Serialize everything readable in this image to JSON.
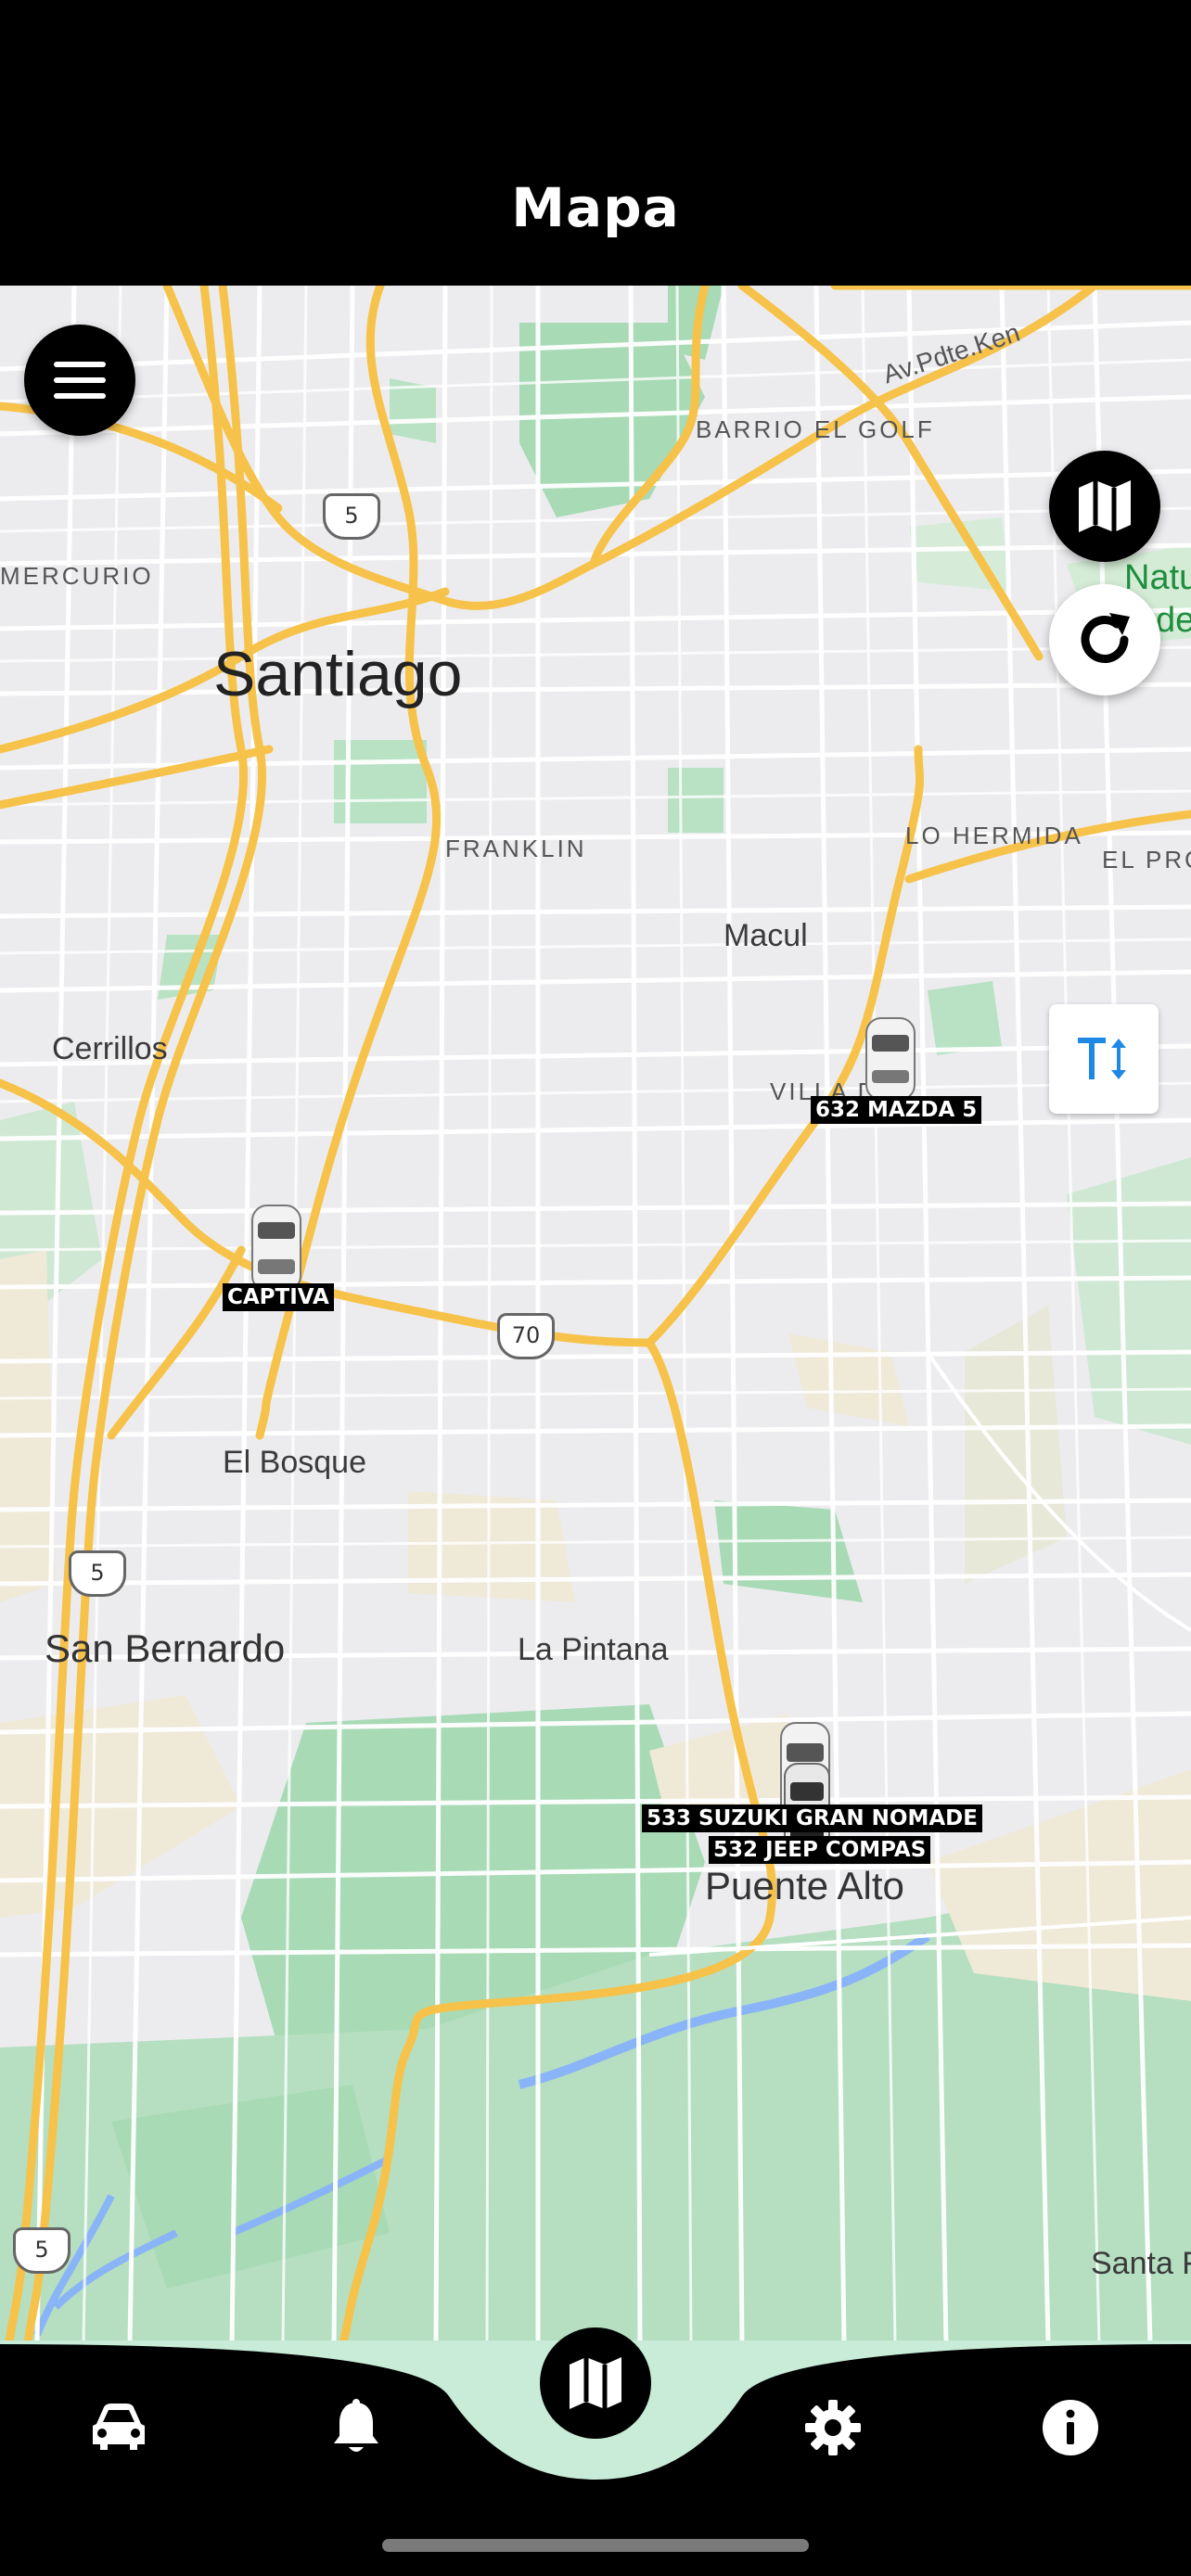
{
  "header": {
    "title": "Mapa"
  },
  "map": {
    "places": {
      "santiago": "Santiago",
      "barrio_el_golf": "BARRIO EL GOLF",
      "mercurio": "MERCURIO",
      "franklin": "FRANKLIN",
      "macul": "Macul",
      "cerrillos": "Cerrillos",
      "lo_hermida": "LO HERMIDA",
      "el_pro": "EL PRO",
      "villa": "VILLA D",
      "el_bosque": "El Bosque",
      "san_bernardo": "San Bernardo",
      "la_pintana": "La Pintana",
      "puente_alto": "Puente Alto",
      "santa": "Santa F",
      "park_1": "Natu",
      "park_2": "de",
      "road_pdte": "Av.Pdte.Ken"
    },
    "shields": {
      "route_5": "5",
      "route_70": "70"
    },
    "vehicles": [
      {
        "label": "632 MAZDA 5"
      },
      {
        "label": "CAPTIVA"
      },
      {
        "label": "533 SUZUKI GRAN NOMADE"
      },
      {
        "label": "532 JEEP COMPAS"
      }
    ],
    "colors": {
      "road_major": "#f6c24a",
      "water": "#8ab4f8",
      "park": "#a8dab5",
      "land": "#ececef"
    }
  },
  "controls": {
    "menu_icon": "menu-icon",
    "map_layers_icon": "map-icon",
    "refresh_icon": "refresh-icon",
    "text_size_icon": "text-size-icon"
  },
  "bottom_nav": {
    "items": [
      "car-icon",
      "bell-icon",
      "map-icon",
      "gear-icon",
      "info-icon"
    ],
    "active": "map-icon",
    "active_color": "#c8ecd8"
  }
}
